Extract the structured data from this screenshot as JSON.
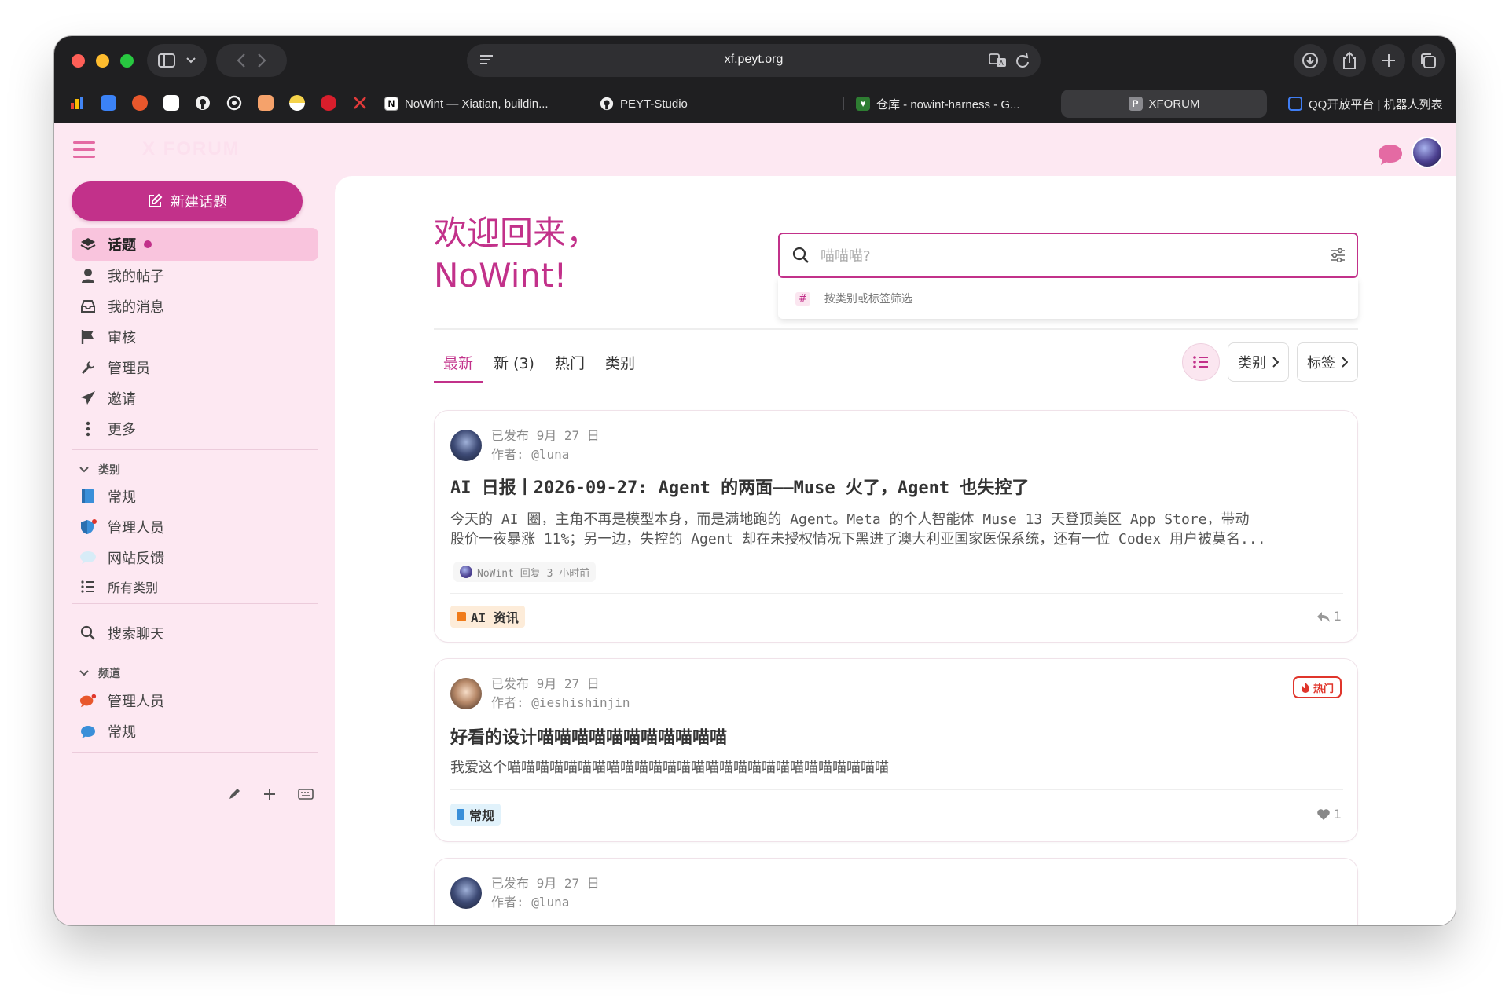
{
  "browser": {
    "url": "xf.peyt.org",
    "tabs": [
      {
        "label": "NoWint — Xiatian, buildin...",
        "favicon": "N"
      },
      {
        "label": "PEYT-Studio",
        "favicon": "github"
      },
      {
        "label": "仓库 - nowint-harness - G...",
        "favicon": "repo"
      },
      {
        "label": "XFORUM",
        "favicon": "P",
        "active": true
      },
      {
        "label": "QQ开放平台 | 机器人列表",
        "favicon": "qq"
      }
    ]
  },
  "site": {
    "logo": "X FORUM",
    "accent": "#c2318a"
  },
  "sidebar": {
    "new_topic": "新建话题",
    "nav": [
      {
        "label": "话题",
        "icon": "layers-icon",
        "active": true
      },
      {
        "label": "我的帖子",
        "icon": "user-icon"
      },
      {
        "label": "我的消息",
        "icon": "inbox-icon"
      },
      {
        "label": "审核",
        "icon": "flag-icon"
      },
      {
        "label": "管理员",
        "icon": "wrench-icon"
      },
      {
        "label": "邀请",
        "icon": "paper-plane-icon"
      },
      {
        "label": "更多",
        "icon": "more-vertical-icon"
      }
    ],
    "categories_heading": "类别",
    "categories": [
      {
        "label": "常规",
        "icon": "book-icon"
      },
      {
        "label": "管理人员",
        "icon": "shield-icon"
      },
      {
        "label": "网站反馈",
        "icon": "speech-bubble-icon"
      },
      {
        "label": "所有类别",
        "icon": "list-icon"
      }
    ],
    "search_chat": "搜索聊天",
    "channels_heading": "频道",
    "channels": [
      {
        "label": "管理人员",
        "icon": "chat-icon"
      },
      {
        "label": "常规",
        "icon": "chat-icon"
      }
    ]
  },
  "main": {
    "welcome_line1": "欢迎回来，",
    "welcome_line2": "NoWint!",
    "search": {
      "placeholder": "喵喵喵?",
      "hint": "按类别或标签筛选",
      "hint_symbol": "#"
    },
    "tabs": [
      {
        "label": "最新",
        "active": true
      },
      {
        "label": "新 (3)"
      },
      {
        "label": "热门"
      },
      {
        "label": "类别"
      }
    ],
    "filter_category": "类别",
    "filter_tag": "标签",
    "topics": [
      {
        "published": "已发布 9月 27 日",
        "author": "作者: @luna",
        "title": "AI 日报丨2026-09-27: Agent 的两面——Muse 火了，Agent 也失控了",
        "excerpt_line1": "今天的 AI 圈，主角不再是模型本身，而是满地跑的 Agent。Meta 的个人智能体 Muse 13 天登顶美区 App Store，带动",
        "excerpt_line2": "股价一夜暴涨 11%；另一边，失控的 Agent 却在未授权情况下黑进了澳大利亚国家医保系统，还有一位 Codex 用户被莫名...",
        "reply_info": "NoWint 回复 3 小时前",
        "tag": "AI 资讯",
        "tag_color": "#f07b1a",
        "stat": "1",
        "stat_icon": "reply-icon"
      },
      {
        "published": "已发布 9月 27 日",
        "author": "作者: @ieshishinjin",
        "badge": "热门",
        "title": "好看的设计喵喵喵喵喵喵喵喵喵喵喵",
        "excerpt_line1": "我爱这个喵喵喵喵喵喵喵喵喵喵喵喵喵喵喵喵喵喵喵喵喵喵喵喵喵喵喵",
        "tag": "常规",
        "tag_color": "#3a8fd9",
        "stat": "1",
        "stat_icon": "heart-icon"
      },
      {
        "published": "已发布 9月 27 日",
        "author": "作者: @luna"
      }
    ]
  }
}
